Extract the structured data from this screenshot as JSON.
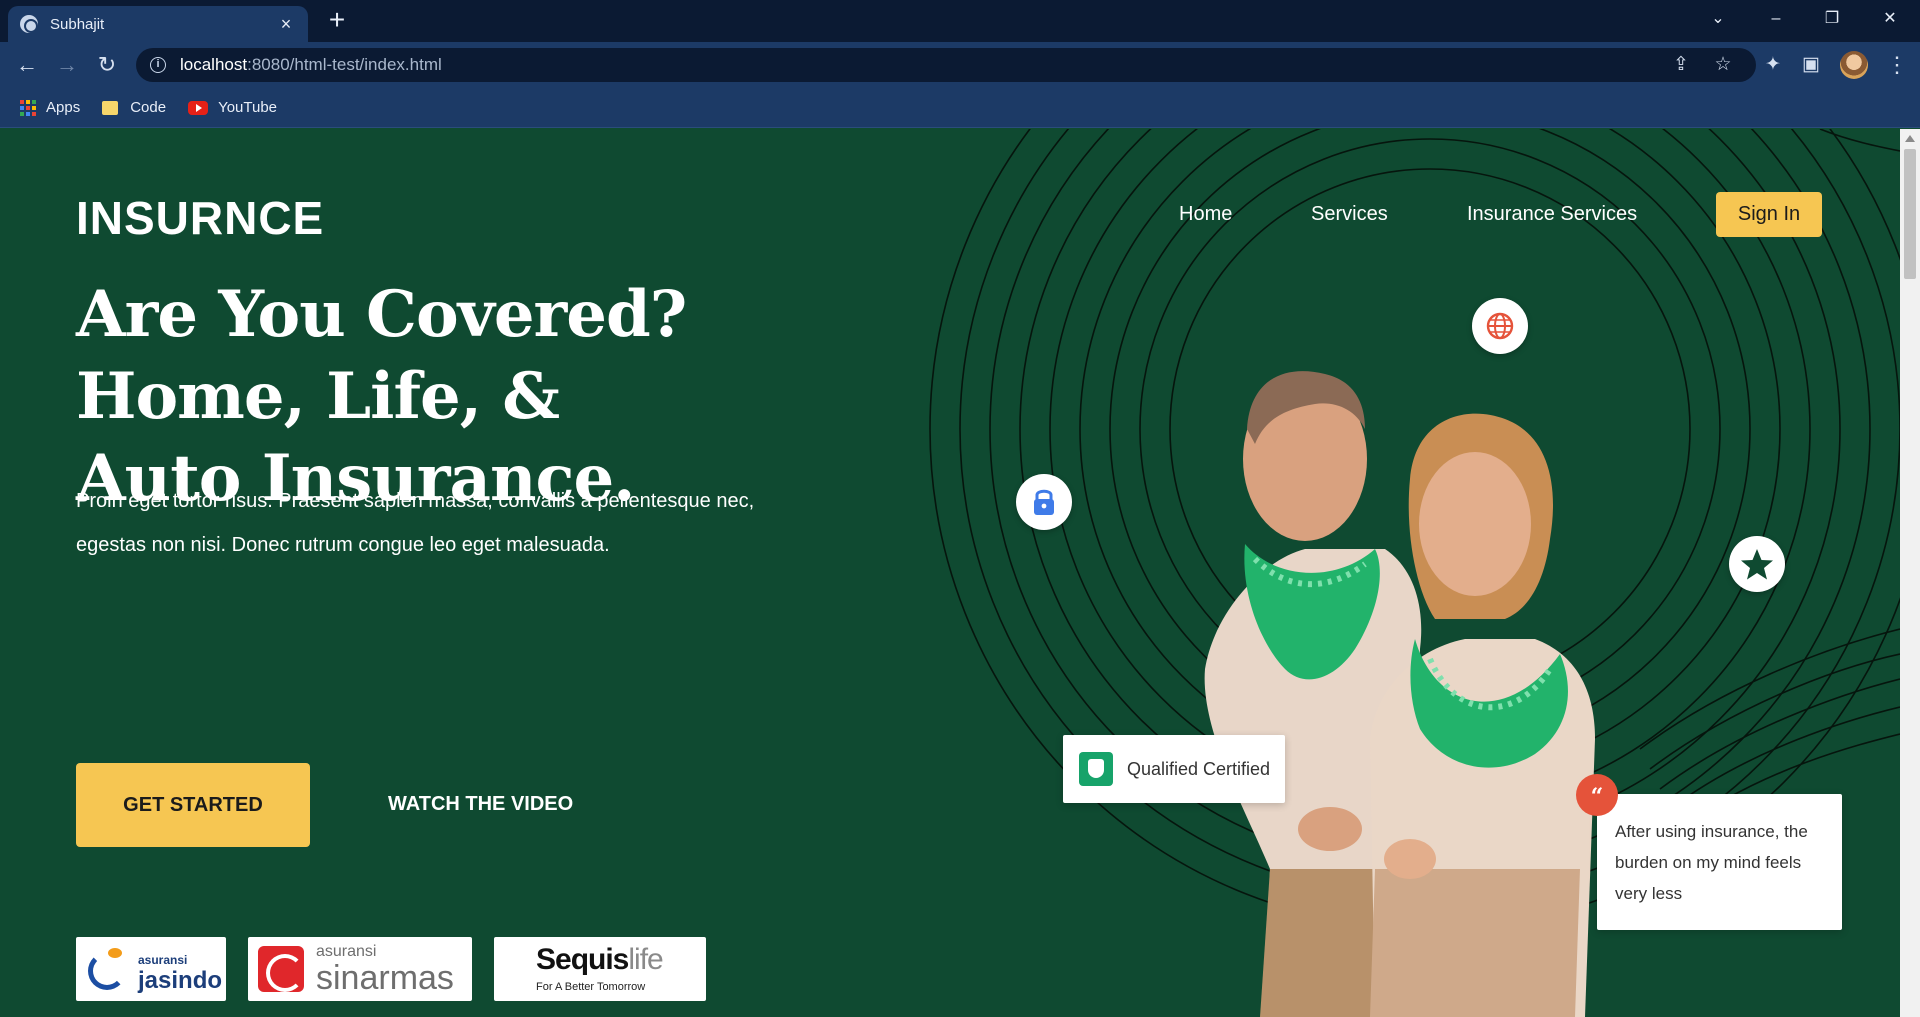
{
  "browser": {
    "tab_title": "Subhajit",
    "tab_close": "×",
    "new_tab": "+",
    "url_host": "localhost",
    "url_rest": ":8080/html-test/index.html",
    "bookmarks": [
      {
        "label": "Apps",
        "icon": "apps-grid-icon"
      },
      {
        "label": "Code",
        "icon": "folder-icon"
      },
      {
        "label": "YouTube",
        "icon": "youtube-icon"
      }
    ],
    "colors": {
      "frame": "#0b1a33",
      "toolbar": "#1c3a66"
    }
  },
  "site": {
    "logo": "INSURNCE",
    "nav": {
      "home": "Home",
      "services": "Services",
      "insurance_services": "Insurance Services"
    },
    "signin_label": "Sign In",
    "hero": {
      "line1": "Are You Covered?",
      "line2": "Home, Life, &",
      "line3": "Auto Insurance.",
      "lead": "Proin eget tortor risus. Praesent sapien massa, convallis a pellentesque nec, egestas non nisi. Donec rutrum congue leo eget malesuada."
    },
    "cta": {
      "primary": "GET STARTED",
      "secondary": "WATCH THE VIDEO"
    },
    "partners": {
      "jasindo": {
        "small": "asuransi",
        "big": "jasindo"
      },
      "sinarmas": {
        "small": "asuransi",
        "big": "sinarmas"
      },
      "sequis": {
        "brand": "Sequis",
        "suffix": "life",
        "tagline": "For A Better Tomorrow"
      }
    },
    "cert_label": "Qualified Certified",
    "quote_mark": "“",
    "testimonial": "After using insurance, the burden on my mind feels very less",
    "colors": {
      "background": "#0f4a31",
      "accent": "#f6c652",
      "quote_badge": "#e5533a",
      "shield": "#17a36a",
      "scarf": "#22b36b"
    }
  }
}
